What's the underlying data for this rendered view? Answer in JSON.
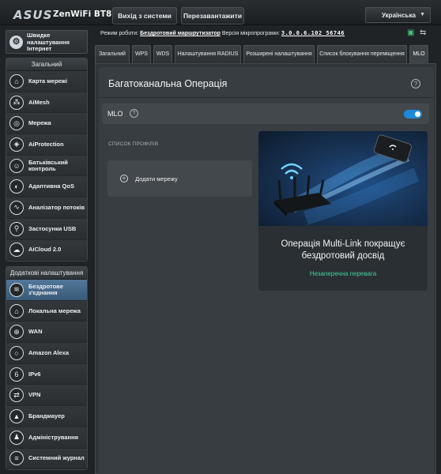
{
  "header": {
    "logo": "ASUS",
    "model": "ZenWiFi BT8",
    "logout_label": "Вихід з системи",
    "reboot_label": "Перезавантажити",
    "language": "Українська"
  },
  "status": {
    "mode_label": "Режим роботи:",
    "mode_value": "Бездротовий маршрутизатор",
    "fw_label": "Версія мікропрограми:",
    "fw_value": "3.0.0.6.102_56746"
  },
  "sidebar": {
    "quick_setup_label": "Швидке налаштування Інтернет",
    "general_title": "Загальний",
    "general_items": [
      {
        "label": "Карта мережі",
        "icon": "network-map-icon"
      },
      {
        "label": "AiMesh",
        "icon": "aimesh-icon"
      },
      {
        "label": "Мережа",
        "icon": "network-icon"
      },
      {
        "label": "AiProtection",
        "icon": "aiprotection-icon"
      },
      {
        "label": "Батьківський контроль",
        "icon": "parental-control-icon"
      },
      {
        "label": "Адаптивна QoS",
        "icon": "qos-icon"
      },
      {
        "label": "Аналізатор потоків",
        "icon": "traffic-analyzer-icon"
      },
      {
        "label": "Застосунки USB",
        "icon": "usb-icon"
      },
      {
        "label": "AiCloud 2.0",
        "icon": "cloud-icon"
      }
    ],
    "advanced_title": "Додаткові налаштування",
    "advanced_items": [
      {
        "label": "Бездротове з'єднання",
        "icon": "wireless-icon"
      },
      {
        "label": "Локальна мережа",
        "icon": "lan-icon"
      },
      {
        "label": "WAN",
        "icon": "wan-icon"
      },
      {
        "label": "Amazon Alexa",
        "icon": "alexa-icon"
      },
      {
        "label": "IPv6",
        "icon": "ipv6-icon"
      },
      {
        "label": "VPN",
        "icon": "vpn-icon"
      },
      {
        "label": "Брандмауер",
        "icon": "firewall-icon"
      },
      {
        "label": "Адміністрування",
        "icon": "administration-icon"
      },
      {
        "label": "Системний журнал",
        "icon": "system-log-icon"
      }
    ]
  },
  "tabs": [
    {
      "label": "Загальний"
    },
    {
      "label": "WPS"
    },
    {
      "label": "WDS"
    },
    {
      "label": "Налаштування RADIUS"
    },
    {
      "label": "Розширені налаштування"
    },
    {
      "label": "Список блокування переміщення"
    },
    {
      "label": "MLO"
    }
  ],
  "main": {
    "title": "Багатоканальна Операція",
    "mlo_label": "MLO",
    "mlo_enabled": true,
    "profiles_label": "СПИСОК ПРОФІЛІВ",
    "add_network_label": "Додати мережу",
    "promo_text": "Операція Multi-Link покращує бездротовий досвід",
    "promo_link": "Незаперечна перевага"
  },
  "colors": {
    "accent": "#1c8ad8",
    "link_green": "#3fd39a",
    "active_nav": "#4a6d8f"
  }
}
